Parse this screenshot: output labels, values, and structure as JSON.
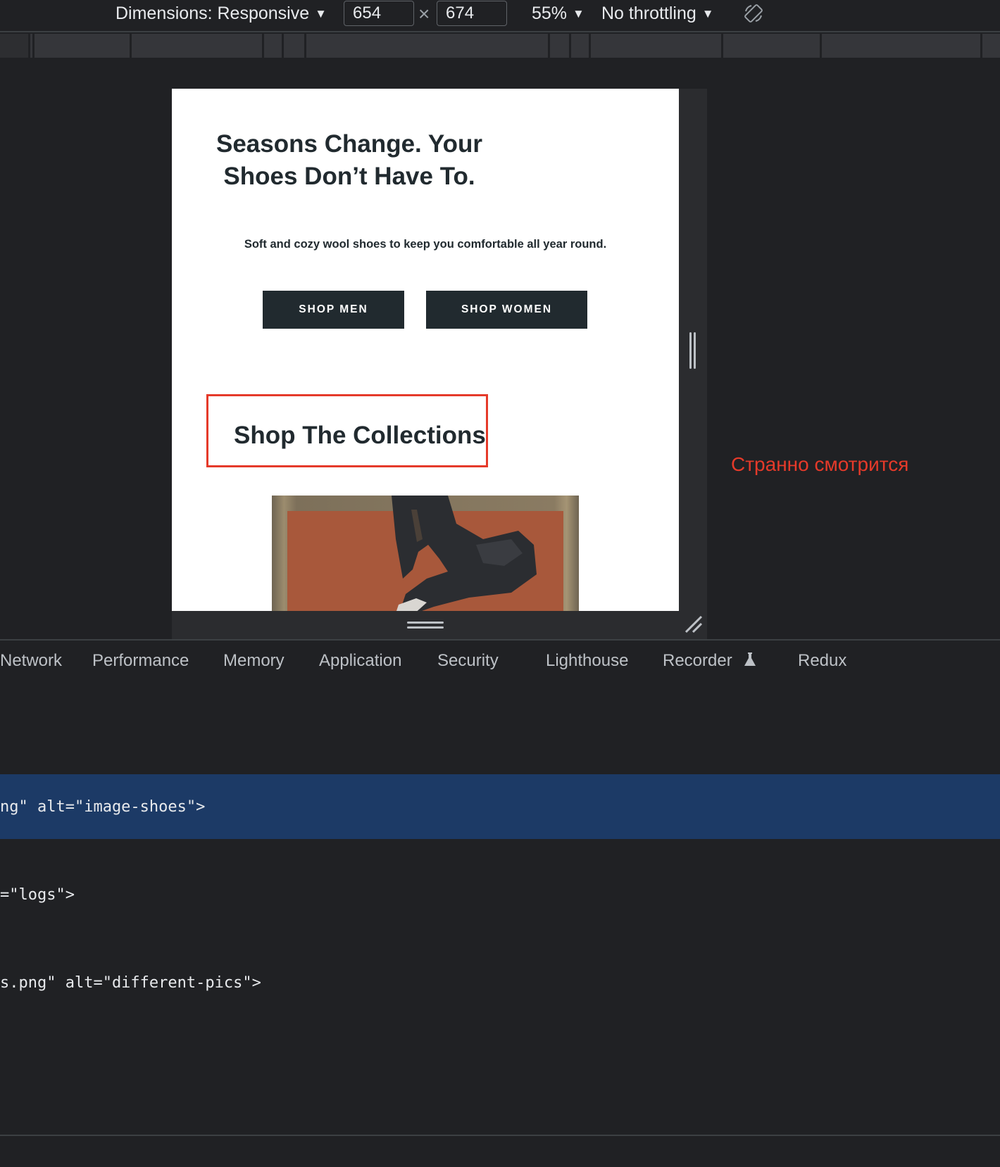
{
  "toolbar": {
    "dimensions_label": "Dimensions: Responsive",
    "width_value": "654",
    "height_value": "674",
    "times_symbol": "×",
    "zoom": "55%",
    "throttling": "No throttling",
    "caret": "▼",
    "rotate_icon": "rotate-icon"
  },
  "page": {
    "hero_title": "Seasons Change. Your Shoes Don’t Have To.",
    "hero_subtitle": "Soft and cozy wool shoes to keep you comfortable all year round.",
    "shop_men": "SHOP MEN",
    "shop_women": "SHOP WOMEN",
    "collections_title": "Shop The Collections",
    "colors": {
      "button": "#212a2f",
      "highlight": "#e53a2a",
      "image_bg": "#a8583b"
    }
  },
  "annotation": "Странно смотрится",
  "devtools_tabs": [
    "Network",
    "Performance",
    "Memory",
    "Application",
    "Security",
    "Lighthouse",
    "Recorder",
    "Redux"
  ],
  "code": {
    "line1": "ng\" alt=\"image-shoes\">",
    "line2": "=\"logs\">",
    "line3": "s.png\" alt=\"different-pics\">"
  }
}
